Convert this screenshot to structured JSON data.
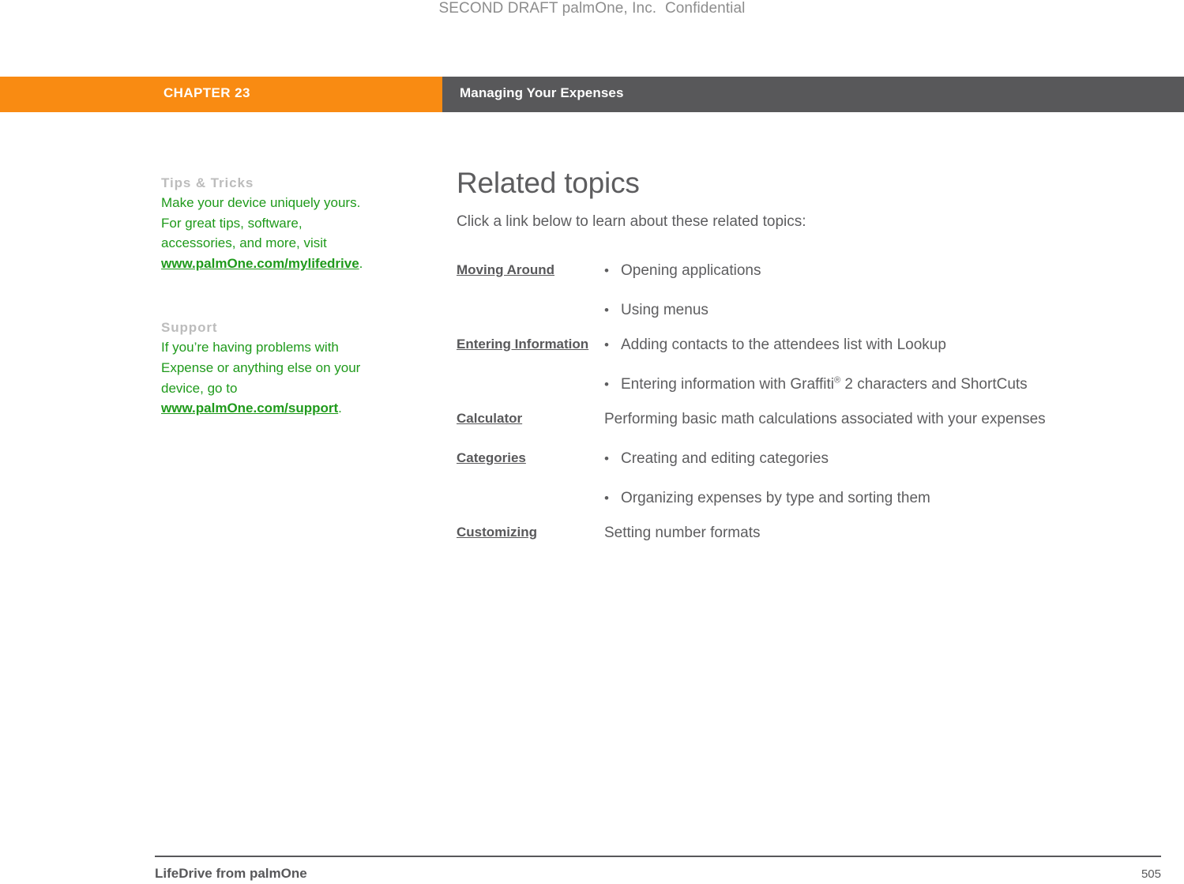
{
  "draft_header": "SECOND DRAFT palmOne, Inc.  Confidential",
  "chapter_bar": {
    "chapter_label": "CHAPTER 23",
    "chapter_title": "Managing Your Expenses",
    "orange_color": "#f98b12",
    "grey_color": "#58585a"
  },
  "sidebar": {
    "blocks": [
      {
        "heading": "Tips & Tricks",
        "body_before": "Make your device uniquely yours. For great tips, software, accessories, and more, visit ",
        "link": "www.palmOne.com/mylifedrive",
        "body_after": "."
      },
      {
        "heading": "Support",
        "body_before": "If you’re having problems with Expense or anything else on your device, go to ",
        "link": "www.palmOne.com/support",
        "body_after": "."
      }
    ],
    "link_color": "#1f9a1b",
    "heading_color": "#bcbcbc"
  },
  "main": {
    "title": "Related topics",
    "intro": "Click a link below to learn about these related topics:"
  },
  "topics": [
    {
      "link": "Moving Around",
      "items": [
        {
          "bullet": "•",
          "text": "Opening applications"
        },
        {
          "bullet": "•",
          "text": "Using menus"
        }
      ]
    },
    {
      "link": "Entering Information",
      "items": [
        {
          "bullet": "•",
          "text": "Adding contacts to the attendees list with Lookup"
        },
        {
          "bullet": "•",
          "text_pre": "Entering information with Graffiti",
          "sup": "®",
          "text_post": " 2 characters and ShortCuts"
        }
      ]
    },
    {
      "link": "Calculator",
      "items": [
        {
          "bullet": "",
          "text": "Performing basic math calculations associated with your expenses"
        }
      ]
    },
    {
      "link": "Categories",
      "items": [
        {
          "bullet": "•",
          "text": "Creating and editing categories"
        },
        {
          "bullet": "•",
          "text": "Organizing expenses by type and sorting them"
        }
      ]
    },
    {
      "link": "Customizing",
      "items": [
        {
          "bullet": "",
          "text": "Setting number formats"
        }
      ]
    }
  ],
  "footer": {
    "left": "LifeDrive from palmOne",
    "page_number": "505"
  }
}
